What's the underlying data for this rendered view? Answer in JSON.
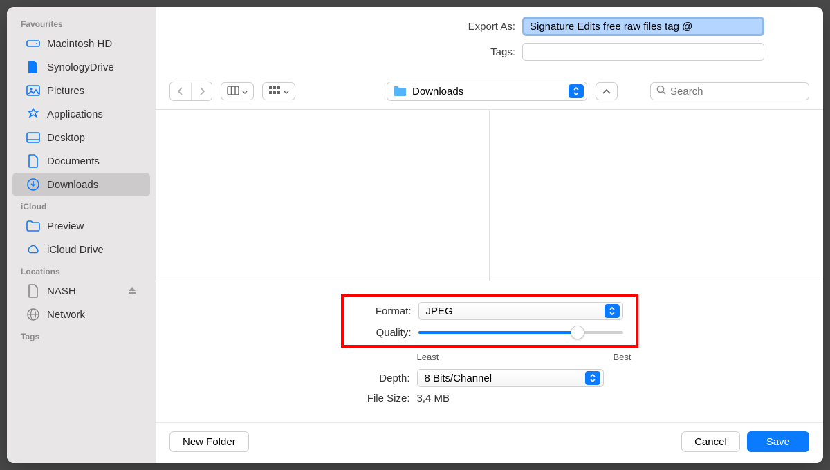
{
  "export": {
    "label": "Export As:",
    "filename": "Signature Edits free raw files tag @",
    "tags_label": "Tags:",
    "tags_value": ""
  },
  "sidebar": {
    "sections": [
      {
        "title": "Favourites",
        "items": [
          {
            "label": "Macintosh HD",
            "icon": "hdd"
          },
          {
            "label": "SynologyDrive",
            "icon": "doc"
          },
          {
            "label": "Pictures",
            "icon": "picture"
          },
          {
            "label": "Applications",
            "icon": "app"
          },
          {
            "label": "Desktop",
            "icon": "desktop"
          },
          {
            "label": "Documents",
            "icon": "doc-outline"
          },
          {
            "label": "Downloads",
            "icon": "download",
            "selected": true
          }
        ]
      },
      {
        "title": "iCloud",
        "items": [
          {
            "label": "Preview",
            "icon": "folder"
          },
          {
            "label": "iCloud Drive",
            "icon": "cloud"
          }
        ]
      },
      {
        "title": "Locations",
        "items": [
          {
            "label": "NASH",
            "icon": "doc-outline",
            "eject": true
          },
          {
            "label": "Network",
            "icon": "globe"
          }
        ]
      },
      {
        "title": "Tags",
        "items": []
      }
    ]
  },
  "toolbar": {
    "location": "Downloads",
    "search_placeholder": "Search"
  },
  "options": {
    "format_label": "Format:",
    "format_value": "JPEG",
    "quality_label": "Quality:",
    "quality_least": "Least",
    "quality_best": "Best",
    "quality_percent": 78,
    "depth_label": "Depth:",
    "depth_value": "8 Bits/Channel",
    "filesize_label": "File Size:",
    "filesize_value": "3,4 MB"
  },
  "footer": {
    "new_folder": "New Folder",
    "cancel": "Cancel",
    "save": "Save"
  }
}
